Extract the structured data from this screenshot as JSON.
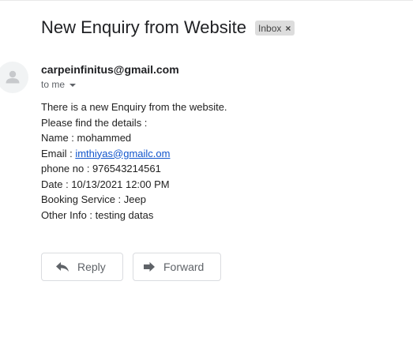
{
  "email": {
    "subject": "New Enquiry from Website",
    "label": {
      "name": "Inbox",
      "close_glyph": "×"
    },
    "sender": "carpeinfinitus@gmail.com",
    "recipient": "to me",
    "avatar_icon": "person-icon",
    "body": {
      "intro": "There is a new Enquiry from the website.",
      "details_heading": "Please find the details :",
      "name_line": "Name : mohammed",
      "email_prefix": "Email : ",
      "email_link": "imthiyas@gmailc.om",
      "phone_line": "phone no : 976543214561",
      "date_line": "Date : 10/13/2021 12:00 PM",
      "service_line": "Booking Service : Jeep",
      "other_line": "Other Info : testing datas"
    }
  },
  "actions": {
    "reply_label": "Reply",
    "reply_icon": "reply-icon",
    "forward_label": "Forward",
    "forward_icon": "forward-icon"
  },
  "colors": {
    "link": "#1155cc",
    "label_chip_bg": "#dddddd",
    "button_border": "#dadce0",
    "secondary_text": "#5f6368"
  }
}
